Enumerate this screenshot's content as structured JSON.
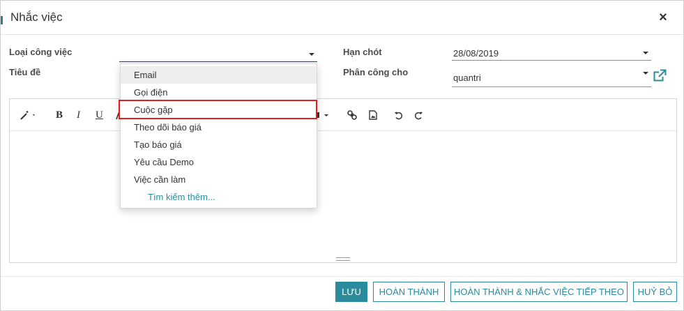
{
  "modal": {
    "title": "Nhắc việc",
    "close_label": "×"
  },
  "form": {
    "activity_type_label": "Loại công việc",
    "activity_type_value": "",
    "summary_label": "Tiêu đề",
    "deadline_label": "Hạn chót",
    "deadline_value": "28/08/2019",
    "assigned_to_label": "Phân công cho",
    "assigned_to_value": "quantri"
  },
  "dropdown": {
    "items": [
      "Email",
      "Gọi điện",
      "Cuộc gặp",
      "Theo dõi báo giá",
      "Tạo báo giá",
      "Yêu cầu Demo",
      "Việc cần làm"
    ],
    "search_more": "Tìm kiếm thêm...",
    "hovered_item": "Email",
    "highlighted_item": "Cuộc gặp"
  },
  "toolbar": {
    "icons": [
      "magic-wand-icon",
      "bold-icon",
      "italic-icon",
      "underline-icon",
      "font-color-icon",
      "table-icon",
      "link-icon",
      "image-icon",
      "undo-icon",
      "redo-icon"
    ],
    "bold": "B",
    "italic": "I",
    "underline": "U"
  },
  "footer": {
    "save": "LƯU",
    "done": "HOÀN THÀNH",
    "done_schedule_next": "HOÀN THÀNH & NHẮC VIỆC TIẾP THEO",
    "discard": "HUỶ BỎ"
  },
  "colors": {
    "accent": "#2a8b9c",
    "highlight_border": "#e0201d"
  }
}
